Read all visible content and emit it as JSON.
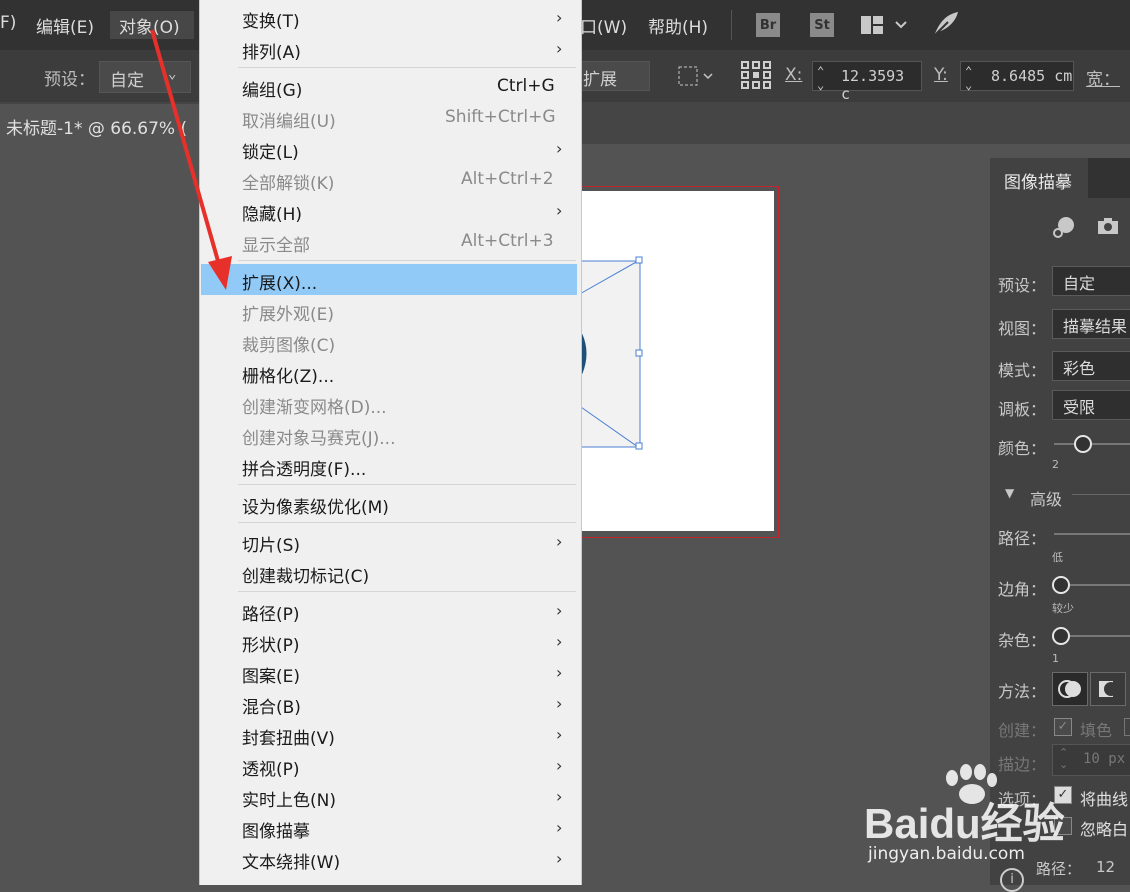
{
  "menubar": {
    "items": [
      "F)",
      "编辑(E)",
      "对象(O)",
      "口(W)",
      "帮助(H)"
    ],
    "app_icons": [
      "Br",
      "St"
    ]
  },
  "controlbar": {
    "preset_label": "预设：",
    "preset_value": "自定",
    "expand_button": "扩展",
    "x_label": "X:",
    "x_value": "12.3593 c",
    "y_label": "Y:",
    "y_value": "8.6485 cm",
    "width_label": "宽："
  },
  "document_tab": {
    "title": "未标题-1* @ 66.67% ("
  },
  "context_menu": {
    "items": [
      {
        "label": "变换(T)",
        "shortcut": "",
        "submenu": true,
        "disabled": false
      },
      {
        "label": "排列(A)",
        "shortcut": "",
        "submenu": true,
        "disabled": false
      },
      {
        "label": "编组(G)",
        "shortcut": "Ctrl+G",
        "submenu": false,
        "disabled": false
      },
      {
        "label": "取消编组(U)",
        "shortcut": "Shift+Ctrl+G",
        "submenu": false,
        "disabled": true
      },
      {
        "label": "锁定(L)",
        "shortcut": "",
        "submenu": true,
        "disabled": false
      },
      {
        "label": "全部解锁(K)",
        "shortcut": "Alt+Ctrl+2",
        "submenu": false,
        "disabled": true
      },
      {
        "label": "隐藏(H)",
        "shortcut": "",
        "submenu": true,
        "disabled": false
      },
      {
        "label": "显示全部",
        "shortcut": "Alt+Ctrl+3",
        "submenu": false,
        "disabled": true
      },
      {
        "label": "扩展(X)...",
        "shortcut": "",
        "submenu": false,
        "disabled": false,
        "highlighted": true
      },
      {
        "label": "扩展外观(E)",
        "shortcut": "",
        "submenu": false,
        "disabled": true
      },
      {
        "label": "裁剪图像(C)",
        "shortcut": "",
        "submenu": false,
        "disabled": true
      },
      {
        "label": "栅格化(Z)...",
        "shortcut": "",
        "submenu": false,
        "disabled": false
      },
      {
        "label": "创建渐变网格(D)...",
        "shortcut": "",
        "submenu": false,
        "disabled": true
      },
      {
        "label": "创建对象马赛克(J)...",
        "shortcut": "",
        "submenu": false,
        "disabled": true
      },
      {
        "label": "拼合透明度(F)...",
        "shortcut": "",
        "submenu": false,
        "disabled": false
      },
      {
        "label": "设为像素级优化(M)",
        "shortcut": "",
        "submenu": false,
        "disabled": false
      },
      {
        "label": "切片(S)",
        "shortcut": "",
        "submenu": true,
        "disabled": false
      },
      {
        "label": "创建裁切标记(C)",
        "shortcut": "",
        "submenu": false,
        "disabled": false
      },
      {
        "label": "路径(P)",
        "shortcut": "",
        "submenu": true,
        "disabled": false
      },
      {
        "label": "形状(P)",
        "shortcut": "",
        "submenu": true,
        "disabled": false
      },
      {
        "label": "图案(E)",
        "shortcut": "",
        "submenu": true,
        "disabled": false
      },
      {
        "label": "混合(B)",
        "shortcut": "",
        "submenu": true,
        "disabled": false
      },
      {
        "label": "封套扭曲(V)",
        "shortcut": "",
        "submenu": true,
        "disabled": false
      },
      {
        "label": "透视(P)",
        "shortcut": "",
        "submenu": true,
        "disabled": false
      },
      {
        "label": "实时上色(N)",
        "shortcut": "",
        "submenu": true,
        "disabled": false
      },
      {
        "label": "图像描摹",
        "shortcut": "",
        "submenu": true,
        "disabled": false
      },
      {
        "label": "文本绕排(W)",
        "shortcut": "",
        "submenu": true,
        "disabled": false
      }
    ]
  },
  "image_trace_panel": {
    "tab_title": "图像描摹",
    "preset_label": "预设：",
    "preset_value": "自定",
    "view_label": "视图：",
    "view_value": "描摹结果",
    "mode_label": "模式：",
    "mode_value": "彩色",
    "palette_label": "调板：",
    "palette_value": "受限",
    "colors_label": "颜色：",
    "colors_value": "2",
    "advanced_label": "高级",
    "paths_label": "路径：",
    "paths_sub": "低",
    "corners_label": "边角：",
    "corners_sub": "较少",
    "noise_label": "杂色：",
    "noise_sub": "1",
    "method_label": "方法：",
    "create_label": "创建：",
    "fill_label": "填色",
    "stroke_label": "描边：",
    "stroke_value": "10 px",
    "options_label": "选项：",
    "curves_label": "将曲线",
    "ignore_white_label": "忽略白",
    "footer_paths_label": "路径：",
    "footer_paths_value": "12"
  },
  "watermark": {
    "brand": "Baidu经验",
    "url": "jingyan.baidu.com"
  },
  "colors": {
    "highlight": "#91c9f7",
    "arrow": "#e8302a",
    "artboard_border": "#c4262e",
    "selection": "#4a7fd4"
  }
}
